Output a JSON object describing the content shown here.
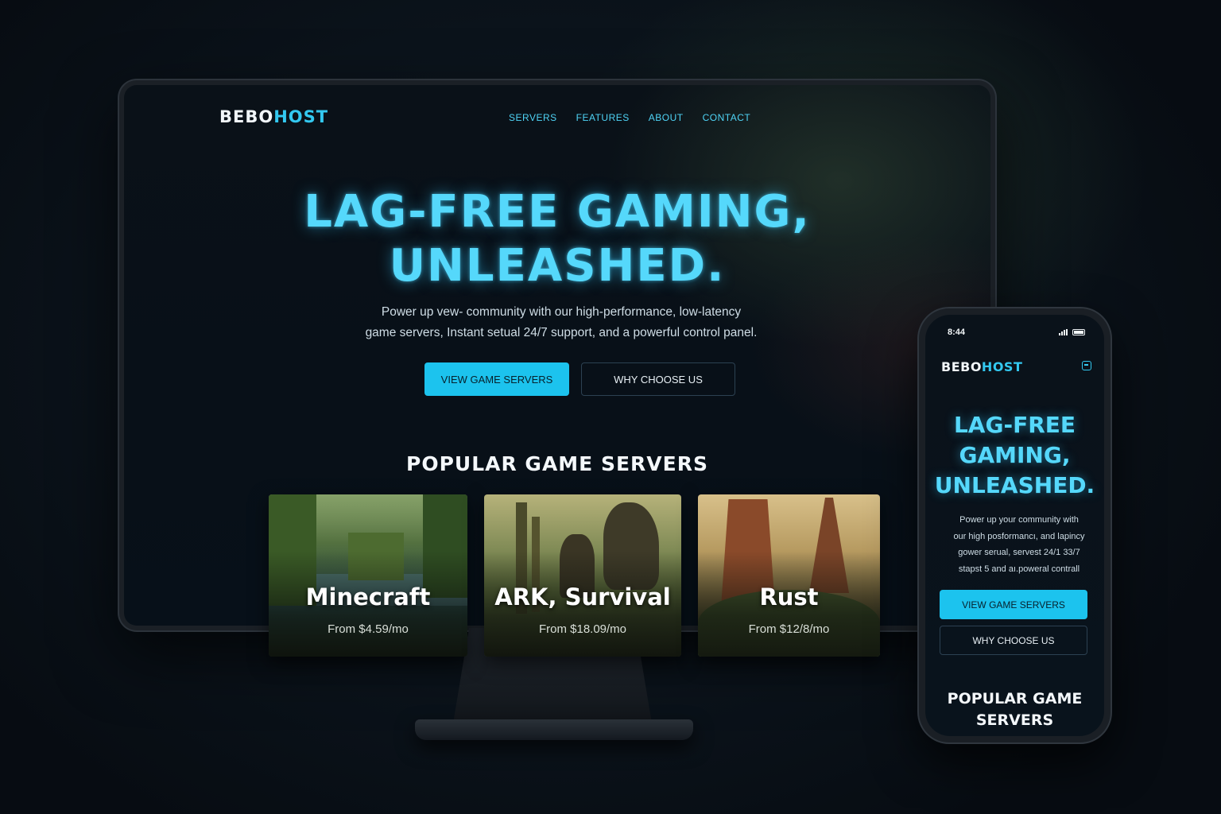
{
  "desktop": {
    "logo": {
      "part1": "BEBO",
      "part2": "HOST"
    },
    "nav": [
      "SERVERS",
      "FEATURES",
      "ABOUT",
      "CONTACT"
    ],
    "hero": {
      "title_line1": "LAG-FREE GAMING,",
      "title_line2": "UNLEASHED.",
      "subtitle_line1": "Power up vew- community with our high-performance, low-latency",
      "subtitle_line2": "game servers, Instant setual 24/7 support, and a powerful control panel.",
      "primary_button": "VIEW GAME SERVERS",
      "secondary_button": "WHY CHOOSE US"
    },
    "section_title": "POPULAR GAME SERVERS",
    "games": [
      {
        "name": "Minecraft",
        "price": "From $4.59/mo"
      },
      {
        "name": "ARK, Survival",
        "price": "From $18.09/mo"
      },
      {
        "name": "Rust",
        "price": "From $12/8/mo"
      }
    ]
  },
  "mobile": {
    "status_time": "8:44",
    "logo": {
      "part1": "BEBO",
      "part2": "HOST"
    },
    "hero": {
      "title_line1": "LAG-FREE",
      "title_line2": "GAMING,",
      "title_line3": "UNLEASHED.",
      "subtitle_lines": [
        "Power up your community with",
        "our high posformancı, and lapincy",
        "gower serual, servest 24/1 33/7",
        "stapst 5 and aı.poweral contrall"
      ],
      "primary_button": "VIEW GAME SERVERS",
      "secondary_button": "WHY CHOOSE US"
    },
    "section_title_line1": "POPULAR GAME",
    "section_title_line2": "SERVERS"
  },
  "colors": {
    "accent": "#1cc3ee",
    "glow_title": "#55d8fb",
    "background": "#0b131b"
  }
}
